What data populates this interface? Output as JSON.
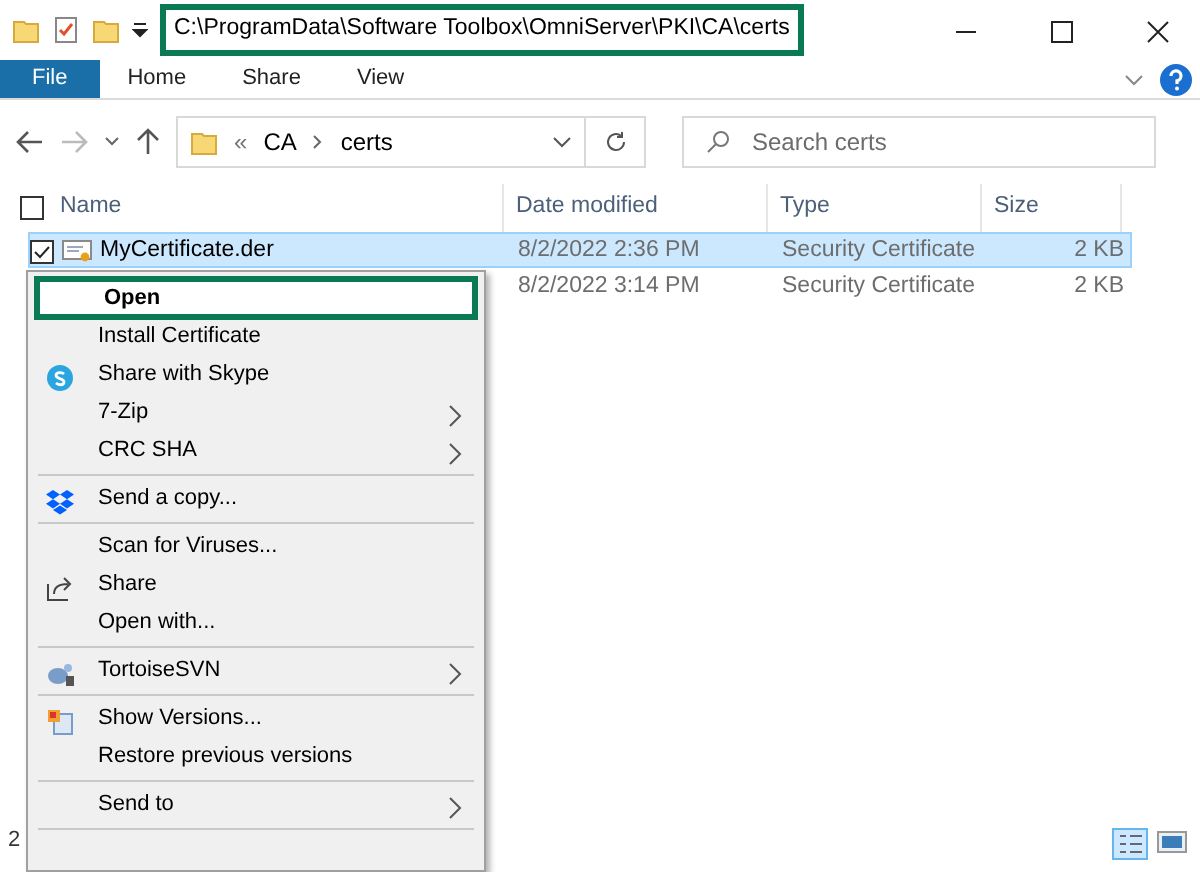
{
  "window": {
    "title": "C:\\ProgramData\\Software Toolbox\\OmniServer\\PKI\\CA\\certs"
  },
  "ribbon_tabs": [
    {
      "label": "File",
      "selected": true
    },
    {
      "label": "Home",
      "selected": false
    },
    {
      "label": "Share",
      "selected": false
    },
    {
      "label": "View",
      "selected": false
    }
  ],
  "address": {
    "overflow": "«",
    "crumbs": [
      "CA",
      "certs"
    ]
  },
  "search": {
    "placeholder": "Search certs"
  },
  "select_all": {
    "checked": false
  },
  "columns": [
    "Name",
    "Date modified",
    "Type",
    "Size"
  ],
  "files": [
    {
      "name": "MyCertificate.der",
      "date": "8/2/2022 2:36 PM",
      "type": "Security Certificate",
      "size": "2 KB",
      "selected": true
    },
    {
      "date": "8/2/2022 3:14 PM",
      "type": "Security Certificate",
      "size": "2 KB",
      "selected": false
    }
  ],
  "status_bar": {
    "text": "2"
  },
  "context_menu": [
    {
      "kind": "item",
      "label": "Open",
      "default": true,
      "submenu": false
    },
    {
      "kind": "item",
      "label": "Install Certificate",
      "default": false,
      "submenu": false
    },
    {
      "kind": "skype",
      "label": "Share with Skype",
      "default": false,
      "submenu": false
    },
    {
      "kind": "item",
      "label": "7-Zip",
      "default": false,
      "submenu": true
    },
    {
      "kind": "item",
      "label": "CRC SHA",
      "default": false,
      "submenu": true
    },
    {
      "kind": "separator"
    },
    {
      "kind": "dropbox",
      "label": "Send a copy...",
      "default": false,
      "submenu": false
    },
    {
      "kind": "separator"
    },
    {
      "kind": "item",
      "label": "Scan for Viruses...",
      "default": false,
      "submenu": false
    },
    {
      "kind": "share",
      "label": "Share",
      "default": false,
      "submenu": false
    },
    {
      "kind": "item",
      "label": "Open with...",
      "default": false,
      "submenu": false
    },
    {
      "kind": "separator"
    },
    {
      "kind": "tortoise",
      "label": "TortoiseSVN",
      "default": false,
      "submenu": true
    },
    {
      "kind": "separator"
    },
    {
      "kind": "versions",
      "label": "Show Versions...",
      "default": false,
      "submenu": false
    },
    {
      "kind": "item",
      "label": "Restore previous versions",
      "default": false,
      "submenu": false
    },
    {
      "kind": "separator"
    },
    {
      "kind": "item",
      "label": "Send to",
      "default": false,
      "submenu": true
    },
    {
      "kind": "separator"
    }
  ]
}
